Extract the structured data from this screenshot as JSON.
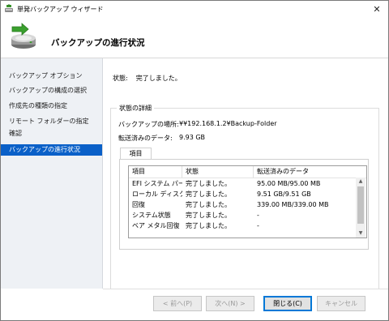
{
  "window": {
    "title": "単発バックアップ ウィザード",
    "close_glyph": "✕"
  },
  "header": {
    "title": "バックアップの進行状況"
  },
  "sidebar": {
    "items": [
      {
        "label": "バックアップ オプション",
        "active": false
      },
      {
        "label": "バックアップの構成の選択",
        "active": false
      },
      {
        "label": "作成先の種類の指定",
        "active": false
      },
      {
        "label": "リモート フォルダーの指定",
        "active": false
      },
      {
        "label": "確認",
        "active": false
      },
      {
        "label": "バックアップの進行状況",
        "active": true
      }
    ]
  },
  "main": {
    "status_label": "状態:",
    "status_value": "完了しました。",
    "details_group_label": "状態の詳細",
    "location_label": "バックアップの場所:",
    "location_value": "¥¥192.168.1.2¥Backup-Folder",
    "transferred_label": "転送済みのデータ:",
    "transferred_value": "9.93 GB",
    "tab_label": "項目",
    "table": {
      "columns": [
        "項目",
        "状態",
        "転送済みのデータ"
      ],
      "rows": [
        [
          "EFI システム パー…",
          "完了しました。",
          "95.00 MB/95.00 MB"
        ],
        [
          "ローカル ディスク…",
          "完了しました。",
          "9.51 GB/9.51 GB"
        ],
        [
          "回復",
          "完了しました。",
          "339.00 MB/339.00 MB"
        ],
        [
          "システム状態",
          "完了しました。",
          "-"
        ],
        [
          "ベア メタル回復",
          "完了しました。",
          "-"
        ]
      ]
    }
  },
  "footer": {
    "prev_label": "< 前へ(P)",
    "next_label": "次へ(N) >",
    "close_label": "閉じる(C)",
    "cancel_label": "キャンセル"
  },
  "icons": {
    "app": "backup-wizard-icon",
    "header": "disk-backup-icon",
    "close": "close-icon",
    "scroll_up": "chevron-up-icon",
    "scroll_down": "chevron-down-icon"
  },
  "colors": {
    "accent": "#0a60c8",
    "sidebar_bg": "#eef1f5",
    "default_button_border": "#0078d7"
  }
}
